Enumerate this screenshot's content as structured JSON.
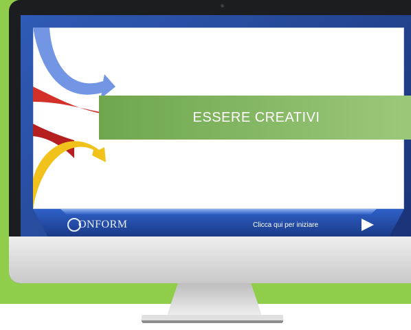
{
  "slide": {
    "title": "ESSERE CREATIVI"
  },
  "player_bar": {
    "logo_text": "ONFORM",
    "start_label": "Clicca qui per iniziare"
  },
  "colors": {
    "background": "#8fcd4a",
    "title_band": "#7ab35a",
    "player_bar": "#2a55b5",
    "arrow_blue": "#6f8fe0",
    "arrow_red": "#d8322a",
    "arrow_yellow": "#f3c21c"
  },
  "icons": [
    "play-icon",
    "conform-logo"
  ]
}
